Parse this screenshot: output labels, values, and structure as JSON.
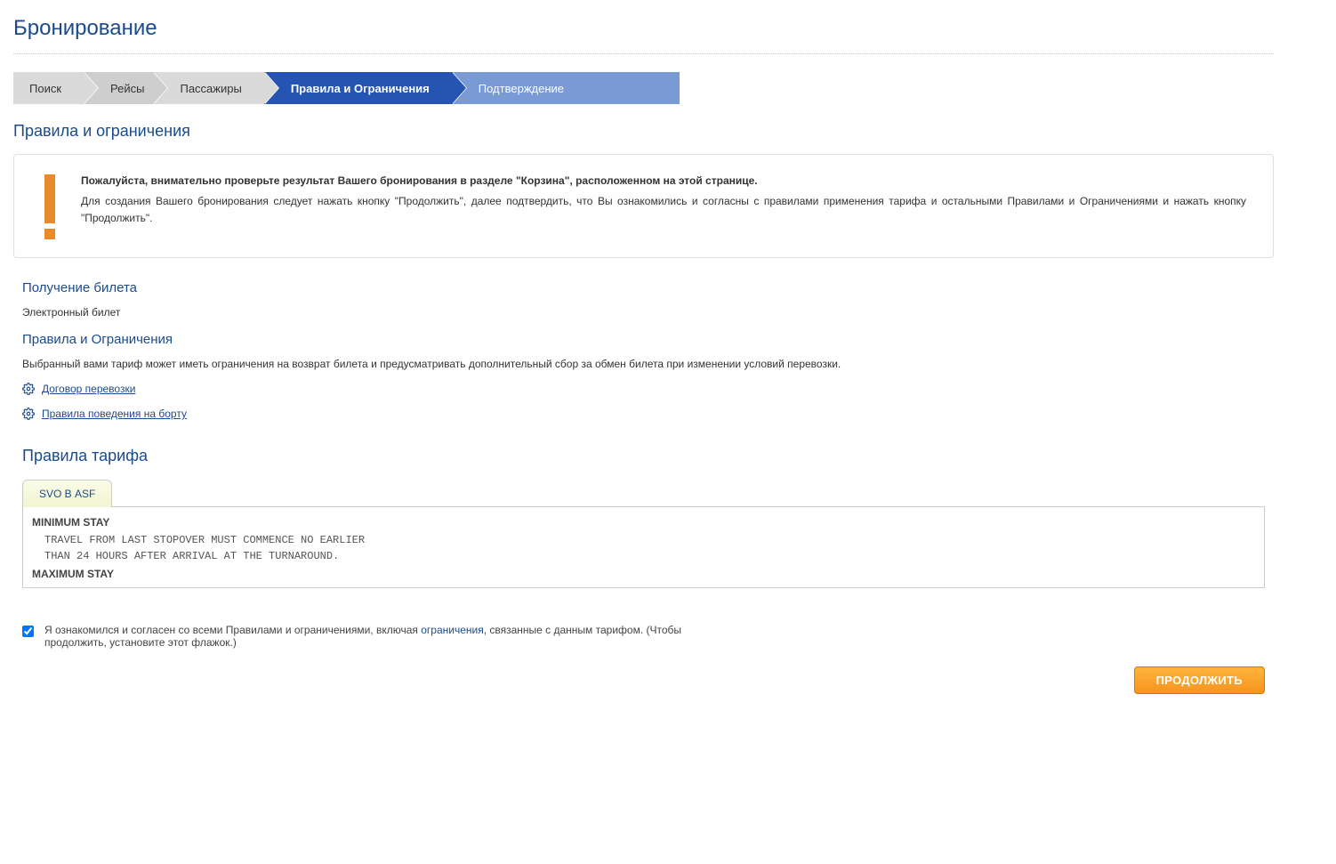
{
  "page": {
    "title": "Бронирование"
  },
  "breadcrumb": {
    "search": "Поиск",
    "flights": "Рейсы",
    "passengers": "Пассажиры",
    "rules": "Правила и Ограничения",
    "confirm": "Подтверждение"
  },
  "section": {
    "rules_title": "Правила и ограничения"
  },
  "notice": {
    "bold": "Пожалуйста, внимательно проверьте результат Вашего бронирования в разделе \"Корзина\", расположенном на этой странице.",
    "text": "Для создания Вашего бронирования следует нажать кнопку \"Продолжить\", далее подтвердить, что Вы ознакомились и согласны с правилами применения тарифа и остальными Правилами и Ограничениями и нажать кнопку \"Продолжить\"."
  },
  "ticket": {
    "heading": "Получение билета",
    "type": "Электронный билет"
  },
  "restrictions": {
    "heading": "Правила и Ограничения",
    "text": "Выбранный вами тариф может иметь ограничения на возврат билета и предусматривать дополнительный сбор за обмен билета при изменении условий перевозки.",
    "link_contract": "Договор перевозки",
    "link_conduct": "Правила поведения на борту"
  },
  "fare": {
    "heading": "Правила тарифа",
    "tab_label": "SVO В ASF",
    "rule1_head": "MINIMUM STAY",
    "rule1_line1": "TRAVEL FROM LAST STOPOVER MUST COMMENCE NO EARLIER",
    "rule1_line2": "THAN 24 HOURS AFTER ARRIVAL AT THE TURNAROUND.",
    "rule2_head": "MAXIMUM STAY"
  },
  "agree": {
    "pre": "Я ознакомился и согласен со всеми Правилами и ограничениями, включая ",
    "link": "ограничения",
    "post": ", связанные с данным тарифом. (Чтобы продолжить, установите этот флажок.)"
  },
  "buttons": {
    "continue": "ПРОДОЛЖИТЬ"
  }
}
